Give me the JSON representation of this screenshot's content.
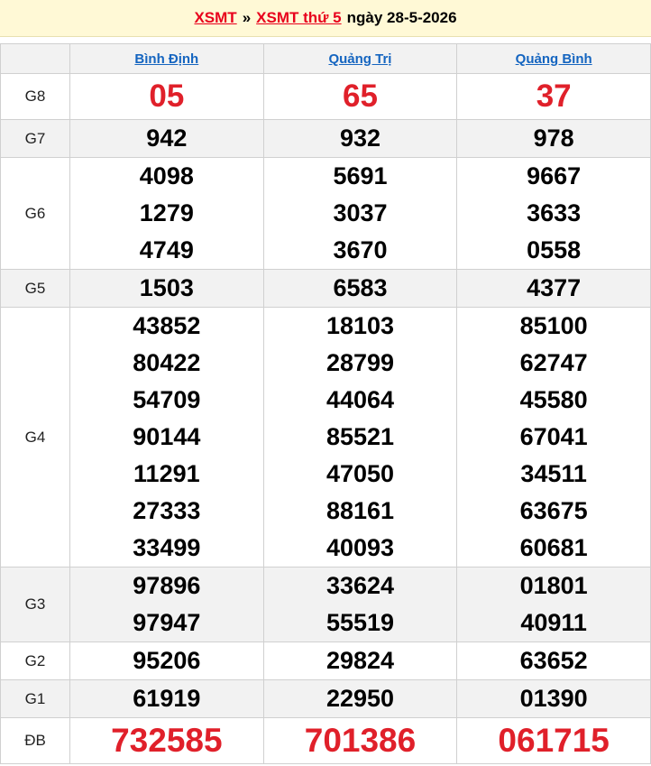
{
  "breadcrumb": {
    "home_link": "XSMT",
    "separator": "»",
    "day_link": "XSMT thứ 5",
    "date_text": "ngày 28-5-2026"
  },
  "provinces": [
    "Bình Định",
    "Quảng Trị",
    "Quảng Bình"
  ],
  "prizes": [
    {
      "label": "G8",
      "values": [
        [
          "05"
        ],
        [
          "65"
        ],
        [
          "37"
        ]
      ]
    },
    {
      "label": "G7",
      "values": [
        [
          "942"
        ],
        [
          "932"
        ],
        [
          "978"
        ]
      ]
    },
    {
      "label": "G6",
      "values": [
        [
          "4098",
          "1279",
          "4749"
        ],
        [
          "5691",
          "3037",
          "3670"
        ],
        [
          "9667",
          "3633",
          "0558"
        ]
      ]
    },
    {
      "label": "G5",
      "values": [
        [
          "1503"
        ],
        [
          "6583"
        ],
        [
          "4377"
        ]
      ]
    },
    {
      "label": "G4",
      "values": [
        [
          "43852",
          "80422",
          "54709",
          "90144",
          "11291",
          "27333",
          "33499"
        ],
        [
          "18103",
          "28799",
          "44064",
          "85521",
          "47050",
          "88161",
          "40093"
        ],
        [
          "85100",
          "62747",
          "45580",
          "67041",
          "34511",
          "63675",
          "60681"
        ]
      ]
    },
    {
      "label": "G3",
      "values": [
        [
          "97896",
          "97947"
        ],
        [
          "33624",
          "55519"
        ],
        [
          "01801",
          "40911"
        ]
      ]
    },
    {
      "label": "G2",
      "values": [
        [
          "95206"
        ],
        [
          "29824"
        ],
        [
          "63652"
        ]
      ]
    },
    {
      "label": "G1",
      "values": [
        [
          "61919"
        ],
        [
          "22950"
        ],
        [
          "01390"
        ]
      ]
    },
    {
      "label": "ĐB",
      "values": [
        [
          "732585"
        ],
        [
          "701386"
        ],
        [
          "061715"
        ]
      ]
    }
  ],
  "colors": {
    "accent_red": "#e0202a",
    "link_blue": "#1565c0",
    "title_bg": "#fff9d6"
  }
}
